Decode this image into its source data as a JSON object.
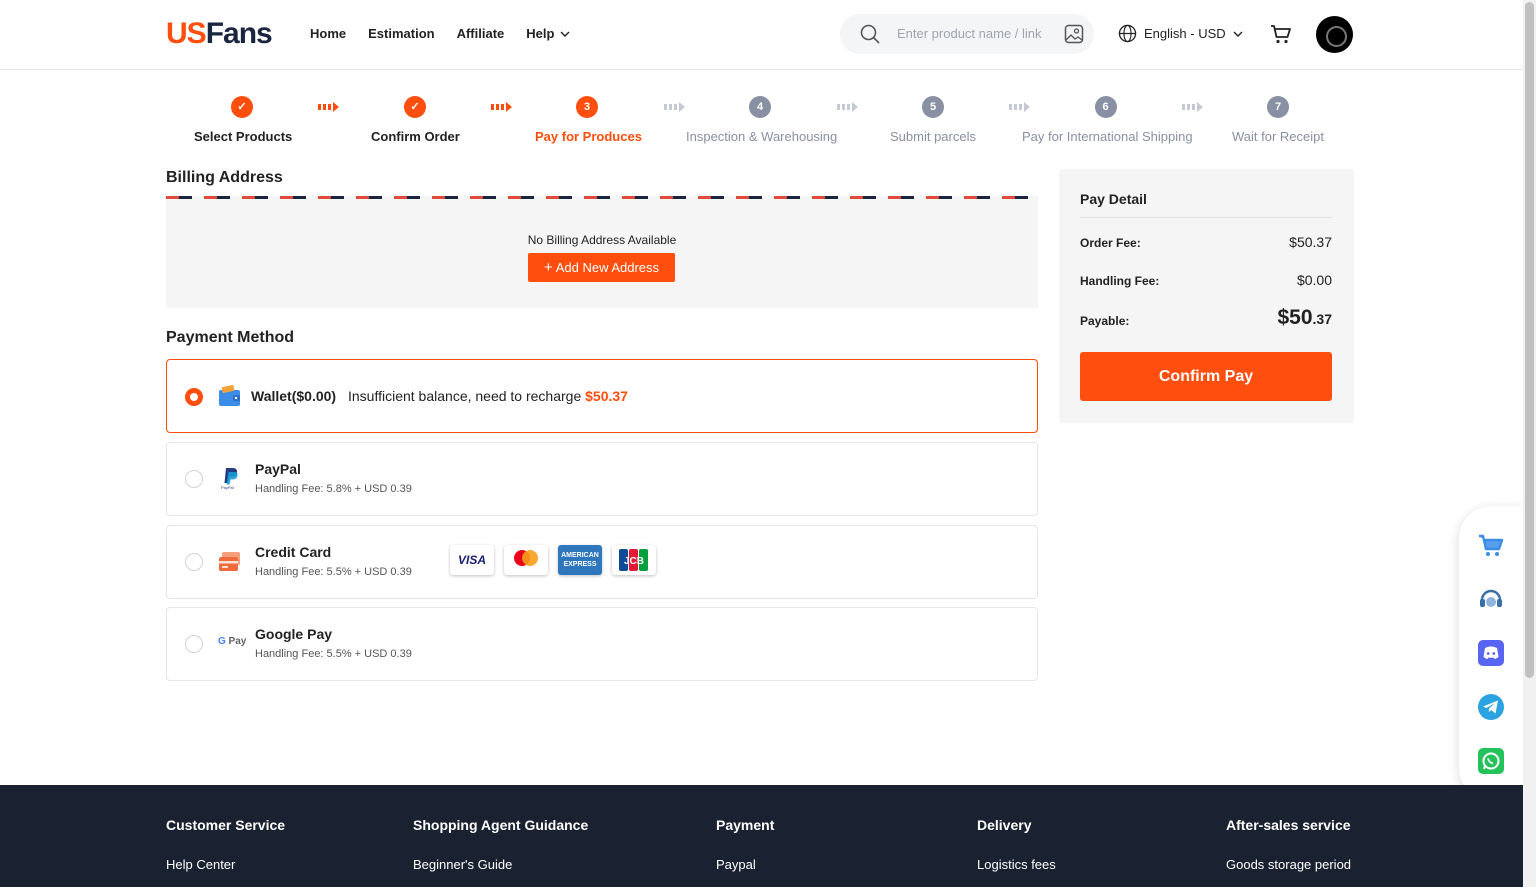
{
  "header": {
    "logo_part1": "US",
    "logo_part2": "Fans",
    "nav": [
      "Home",
      "Estimation",
      "Affiliate",
      "Help"
    ],
    "search_placeholder": "Enter product name / link",
    "language": "English - USD"
  },
  "steps": [
    {
      "num": "✓",
      "label": "Select Products",
      "state": "done"
    },
    {
      "num": "✓",
      "label": "Confirm Order",
      "state": "done"
    },
    {
      "num": "3",
      "label": "Pay for Produces",
      "state": "active"
    },
    {
      "num": "4",
      "label": "Inspection & Warehousing",
      "state": "todo"
    },
    {
      "num": "5",
      "label": "Submit parcels",
      "state": "todo"
    },
    {
      "num": "6",
      "label": "Pay for International Shipping",
      "state": "todo"
    },
    {
      "num": "7",
      "label": "Wait for Receipt",
      "state": "todo"
    }
  ],
  "billing": {
    "title": "Billing Address",
    "empty_text": "No Billing Address Available",
    "add_button": "Add New Address"
  },
  "payment": {
    "title": "Payment Method",
    "wallet": {
      "name": "Wallet($0.00)",
      "message": "Insufficient balance, need to recharge",
      "amount": "$50.37"
    },
    "methods": [
      {
        "name": "PayPal",
        "fee": "Handling Fee: 5.8% + USD 0.39"
      },
      {
        "name": "Credit Card",
        "fee": "Handling Fee: 5.5% + USD 0.39"
      },
      {
        "name": "Google Pay",
        "fee": "Handling Fee: 5.5% + USD 0.39"
      }
    ],
    "card_logos": [
      "VISA",
      "mastercard",
      "AMERICAN EXPRESS",
      "JCB"
    ]
  },
  "pay_detail": {
    "title": "Pay Detail",
    "order_fee_label": "Order Fee:",
    "order_fee": "$50.37",
    "handling_fee_label": "Handling Fee:",
    "handling_fee": "$0.00",
    "payable_label": "Payable:",
    "payable_main": "$50",
    "payable_cents": ".37",
    "confirm_button": "Confirm Pay"
  },
  "floating_icons": [
    "cart-icon",
    "support-icon",
    "discord-icon",
    "telegram-icon",
    "whatsapp-icon"
  ],
  "footer": [
    {
      "heading": "Customer Service",
      "link": "Help Center"
    },
    {
      "heading": "Shopping Agent Guidance",
      "link": "Beginner's Guide"
    },
    {
      "heading": "Payment",
      "link": "Paypal"
    },
    {
      "heading": "Delivery",
      "link": "Logistics fees"
    },
    {
      "heading": "After-sales service",
      "link": "Goods storage period"
    }
  ],
  "colors": {
    "accent": "#ff4e0d",
    "navy": "#1a2540",
    "footer_bg": "#1a2130",
    "muted": "#8a90a3"
  }
}
